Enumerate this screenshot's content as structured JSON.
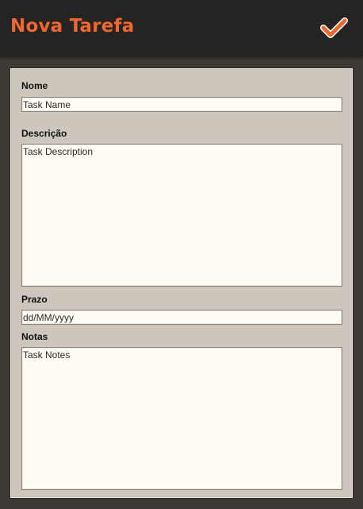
{
  "header": {
    "title": "Nova Tarefa",
    "confirm_icon": "checkmark-icon",
    "accent_color": "#ee6730"
  },
  "form": {
    "name": {
      "label": "Nome",
      "placeholder": "Task Name",
      "value": ""
    },
    "description": {
      "label": "Descrição",
      "placeholder": "Task Description",
      "value": ""
    },
    "deadline": {
      "label": "Prazo",
      "placeholder": "dd/MM/yyyy",
      "value": ""
    },
    "notes": {
      "label": "Notas",
      "placeholder": "Task Notes",
      "value": ""
    }
  }
}
